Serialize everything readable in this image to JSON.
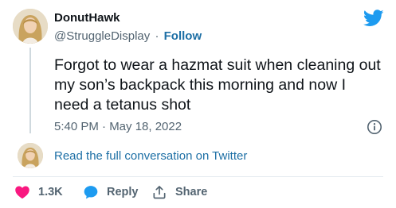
{
  "author": {
    "display_name": "DonutHawk",
    "handle": "@StruggleDisplay",
    "separator": "·",
    "follow_label": "Follow"
  },
  "tweet": {
    "text": "Forgot to wear a hazmat suit when cleaning out my son’s backpack this morning and now I need a tetanus shot",
    "timestamp": "5:40 PM · May 18, 2022"
  },
  "conversation": {
    "link_label": "Read the full conversation on Twitter"
  },
  "actions": {
    "like_count": "1.3K",
    "reply_label": "Reply",
    "share_label": "Share"
  },
  "icons": {
    "brand": "twitter-bird-icon",
    "info": "info-icon",
    "like": "heart-icon",
    "reply": "speech-bubble-icon",
    "share": "share-upload-icon"
  },
  "colors": {
    "brand_blue": "#1d9bf0",
    "link_blue": "#1d6fa5",
    "like_red": "#f91880",
    "text_primary": "#0f1419",
    "text_secondary": "#536471"
  }
}
